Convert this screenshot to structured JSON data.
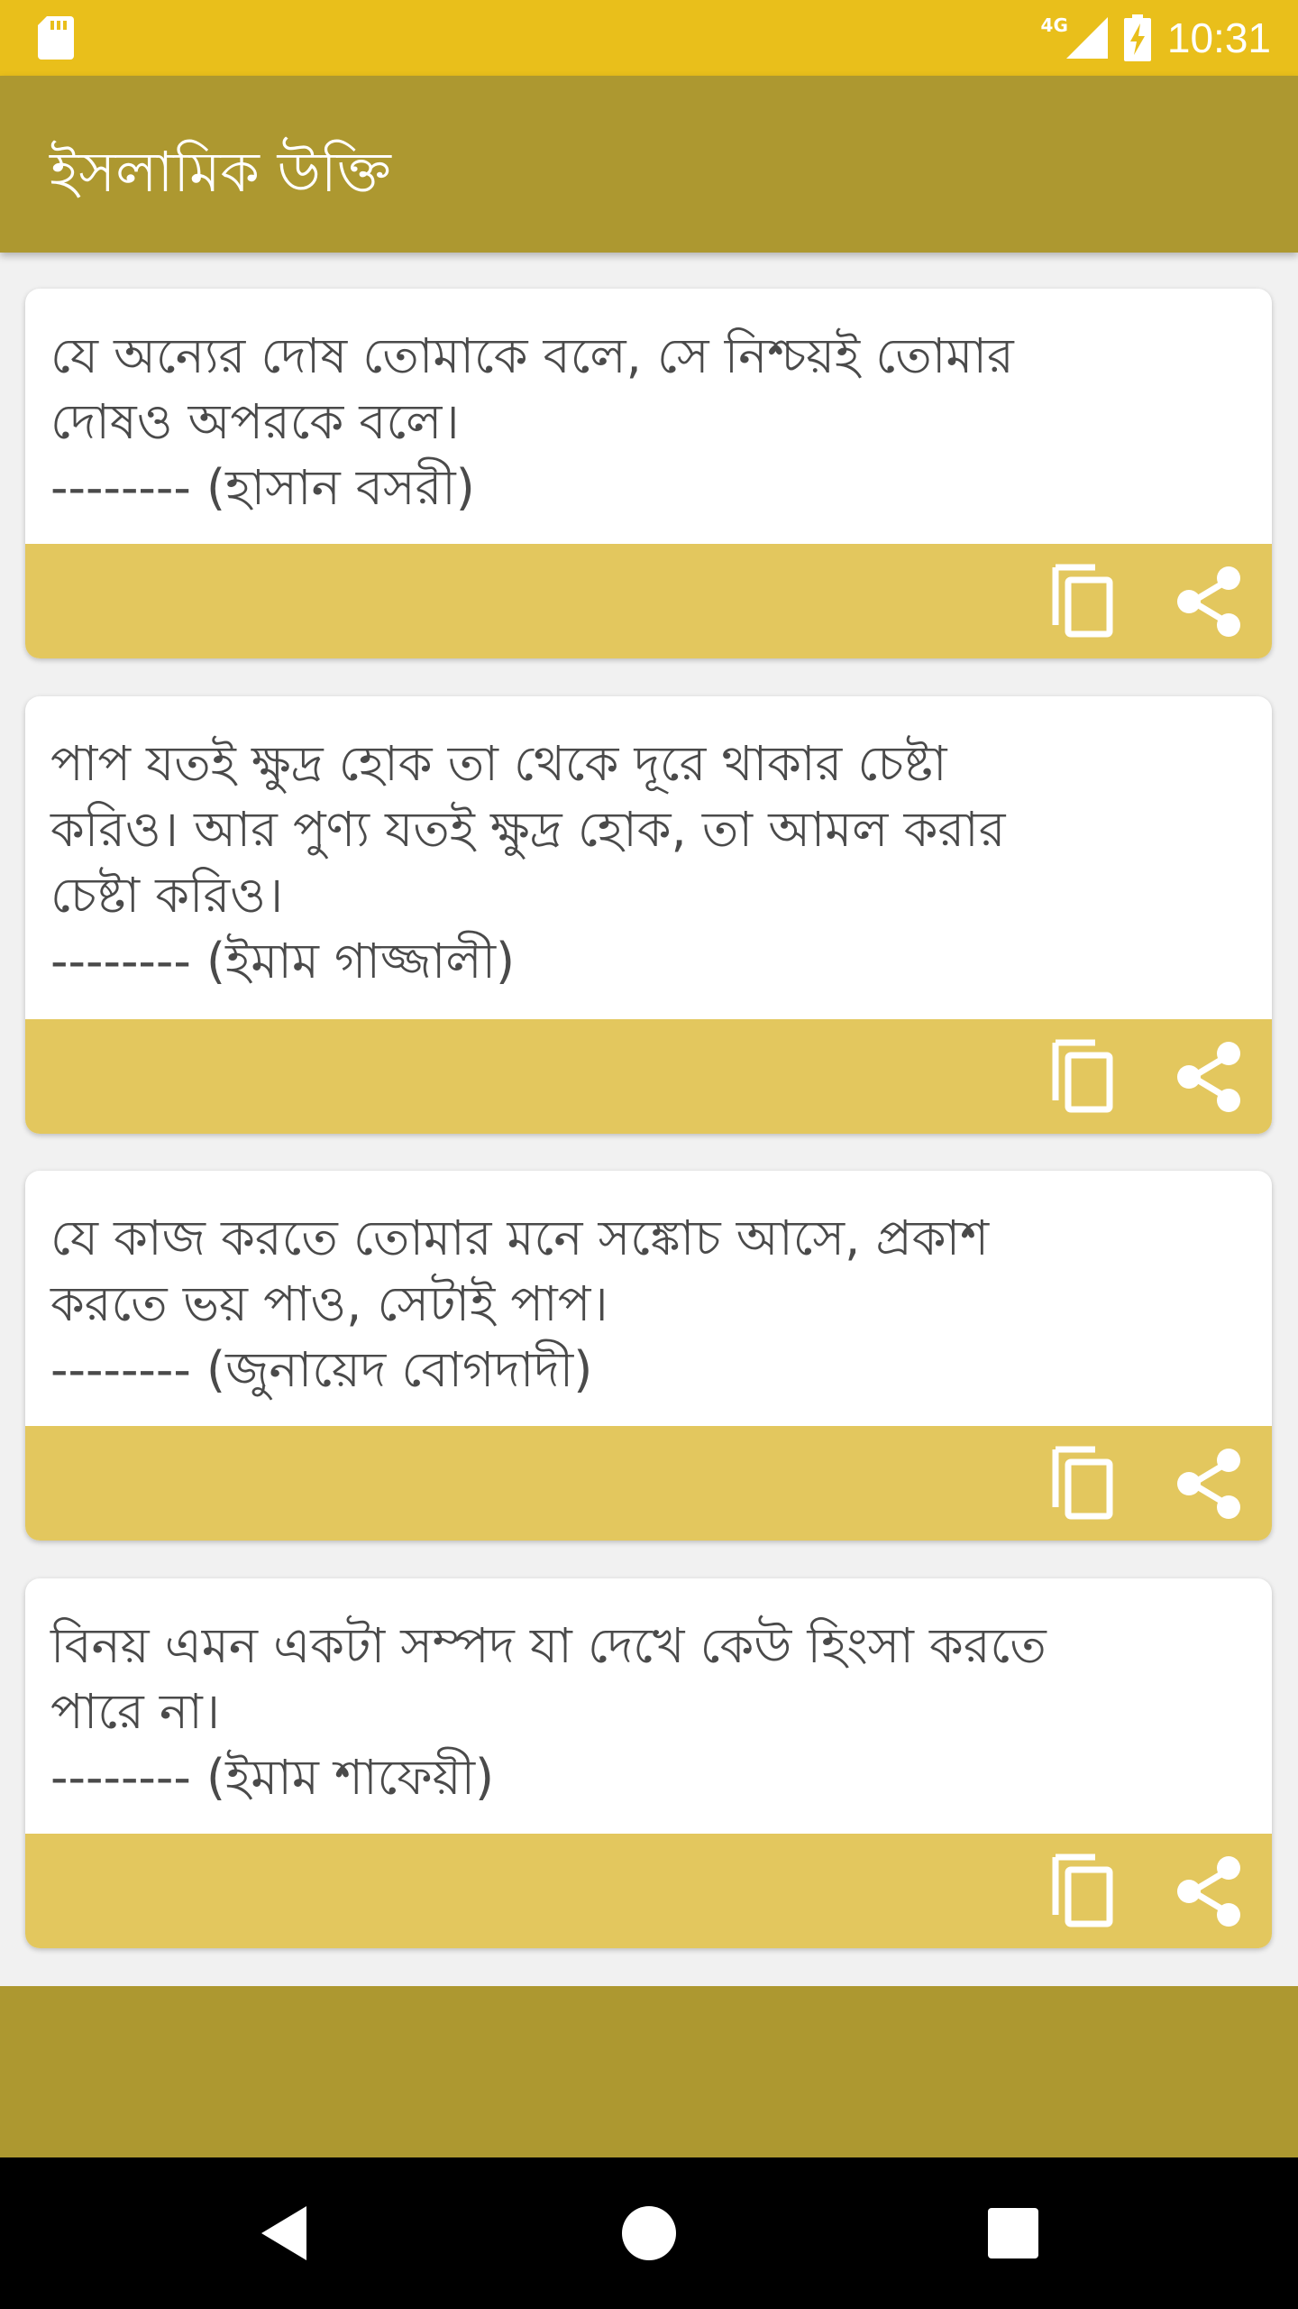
{
  "status_bar": {
    "network": "4G",
    "time": "10:31",
    "icons": [
      "sd-card-icon",
      "signal-icon",
      "battery-charging-icon"
    ]
  },
  "app_bar": {
    "title": "ইসলামিক উক্তি"
  },
  "quotes": [
    {
      "text": "যে অন্যের দোষ তোমাকে বলে, সে নিশ্চয়ই তোমার\nদোষও অপরকে বলে।\n-------- (হাসান বসরী)"
    },
    {
      "text": "পাপ যতই ক্ষুদ্র হোক তা থেকে দূরে থাকার চেষ্টা\nকরিও। আর পুণ্য যতই ক্ষুদ্র হোক, তা আমল করার\nচেষ্টা করিও।\n-------- (ইমাম গাজ্জালী)"
    },
    {
      "text": "যে কাজ করতে তোমার মনে সঙ্কোচ আসে, প্রকাশ\nকরতে ভয় পাও, সেটাই পাপ।\n-------- (জুনায়েদ বোগদাদী)"
    },
    {
      "text": "বিনয় এমন একটা সম্পদ যা দেখে কেউ হিংসা করতে\nপারে না।\n-------- (ইমাম শাফেয়ী)"
    }
  ],
  "card_actions": {
    "icons": [
      "copy-icon",
      "share-icon"
    ]
  },
  "navigation": {
    "icons": [
      "back-icon",
      "home-icon",
      "recents-icon"
    ]
  },
  "colors": {
    "status_bar": "#e9bf1b",
    "app_bar": "#ad9830",
    "action_bar": "#e3c75e",
    "background": "#f1f1f1"
  }
}
